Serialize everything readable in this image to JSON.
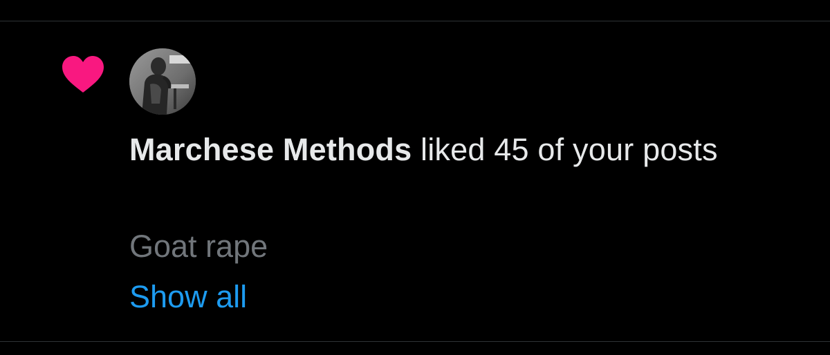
{
  "notification": {
    "icon": "heart-icon",
    "icon_color": "#f91880",
    "avatar": "avatar-photo",
    "actor_name": "Marchese Methods",
    "action_text": "liked 45 of your posts",
    "post_preview": "Goat rape",
    "show_all_label": "Show all",
    "link_color": "#1d9bf0",
    "secondary_text_color": "#71767b"
  }
}
